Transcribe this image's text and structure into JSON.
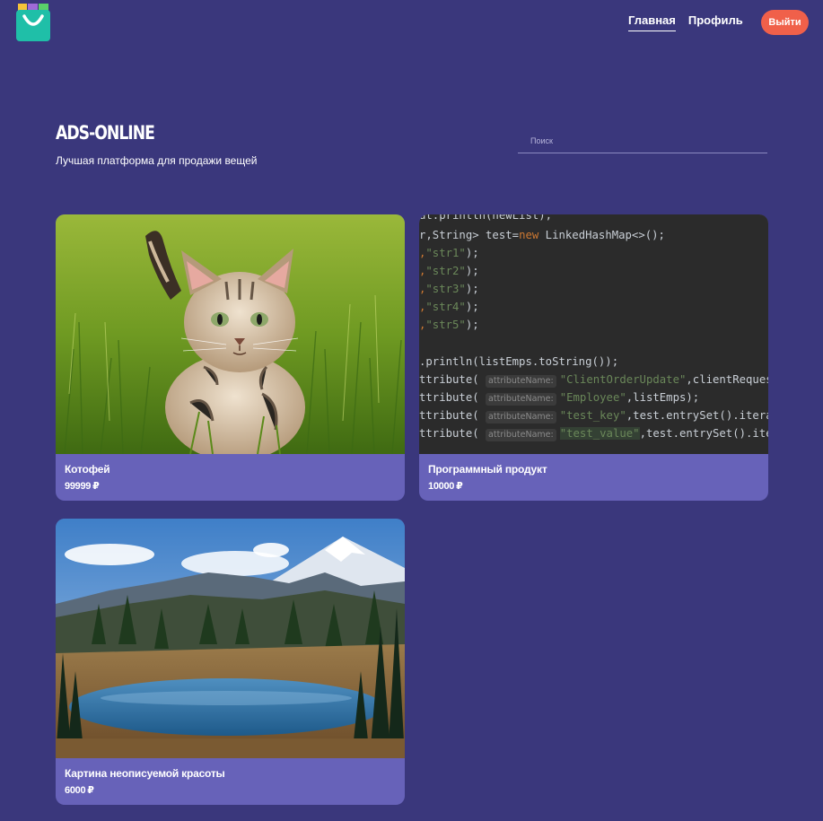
{
  "header": {
    "nav": [
      {
        "label": "Главная",
        "active": true
      },
      {
        "label": "Профиль",
        "active": false
      }
    ],
    "logout_label": "Выйти",
    "logo_icon": "shopping-bag-icon",
    "accent_color": "#f0604a"
  },
  "hero": {
    "title": "ADS-ONLINE",
    "subtitle": "Лучшая платформа для продажи вещей"
  },
  "search": {
    "placeholder": "Поиск",
    "value": ""
  },
  "ads": [
    {
      "title": "Котофей",
      "price": "99999",
      "currency": "₽",
      "image": "kitten-photo"
    },
    {
      "title": "Программный продукт",
      "price": "10000",
      "currency": "₽",
      "image": "code-screenshot"
    },
    {
      "title": "Картина неописуемой красоты",
      "price": "6000",
      "currency": "₽",
      "image": "mountain-lake-photo"
    }
  ],
  "code_snippet": {
    "lines": [
      "ut.println(newList);",
      "r,String> test=new LinkedHashMap<>();",
      ",\"str1\");",
      ",\"str2\");",
      ",\"str3\");",
      ",\"str4\");",
      ",\"str5\");",
      "",
      ".println(listEmps.toString());",
      "ttribute( attributeName: \"ClientOrderUpdate\",clientReques",
      "ttribute( attributeName: \"Employee\",listEmps);",
      "ttribute( attributeName: \"test_key\",test.entrySet().itera",
      "ttribute( attributeName: \"test_value\",test.entrySet().ite"
    ]
  }
}
